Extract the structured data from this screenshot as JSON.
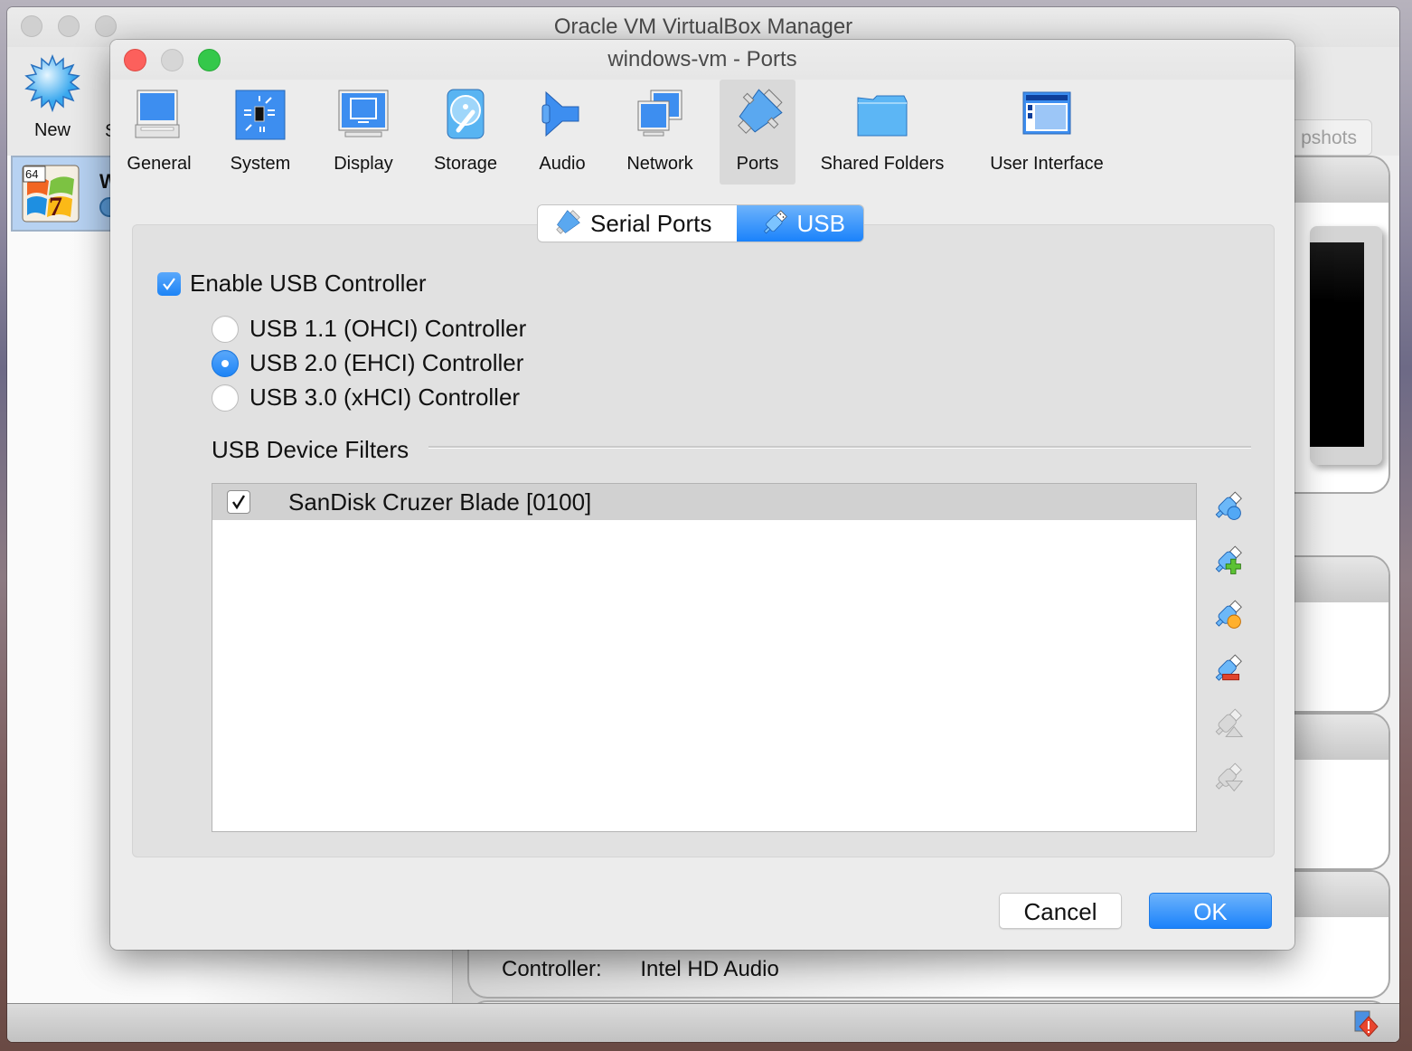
{
  "manager": {
    "title": "Oracle VM VirtualBox Manager",
    "toolbar": {
      "new_label": "New",
      "partial_label": "S",
      "snapshots_label": "Snapshots",
      "snapshots_visible": "pshots"
    },
    "vm_list": [
      {
        "name": "W",
        "os_badge": "64",
        "os_version": "7",
        "state_icon": "power-icon"
      }
    ],
    "details": {
      "audio_controller_label": "Controller:",
      "audio_controller_value": "Intel HD Audio"
    },
    "statusbar": {
      "icon": "network-warning-icon"
    }
  },
  "dialog": {
    "title": "windows-vm - Ports",
    "categories": [
      {
        "label": "General",
        "icon": "general-icon"
      },
      {
        "label": "System",
        "icon": "system-icon"
      },
      {
        "label": "Display",
        "icon": "display-icon"
      },
      {
        "label": "Storage",
        "icon": "storage-icon"
      },
      {
        "label": "Audio",
        "icon": "audio-icon"
      },
      {
        "label": "Network",
        "icon": "network-icon"
      },
      {
        "label": "Ports",
        "icon": "ports-icon",
        "selected": true
      },
      {
        "label": "Shared Folders",
        "icon": "shared-folders-icon"
      },
      {
        "label": "User Interface",
        "icon": "user-interface-icon"
      }
    ],
    "tabs": [
      {
        "label": "Serial Ports",
        "icon": "serial-port-icon",
        "selected": false
      },
      {
        "label": "USB",
        "icon": "usb-icon",
        "selected": true
      }
    ],
    "usb": {
      "enable_label": "Enable USB Controller",
      "enable_checked": true,
      "controllers": [
        {
          "label": "USB 1.1 (OHCI) Controller",
          "selected": false
        },
        {
          "label": "USB 2.0 (EHCI) Controller",
          "selected": true
        },
        {
          "label": "USB 3.0 (xHCI) Controller",
          "selected": false
        }
      ],
      "filters_label": "USB Device Filters",
      "filters": [
        {
          "label": "SanDisk Cruzer Blade [0100]",
          "checked": true
        }
      ],
      "filter_actions": [
        {
          "name": "add-empty-filter",
          "icon": "usb-add-empty-icon",
          "enabled": true
        },
        {
          "name": "add-filter-from-device",
          "icon": "usb-add-icon",
          "enabled": true
        },
        {
          "name": "edit-filter",
          "icon": "usb-edit-icon",
          "enabled": true
        },
        {
          "name": "remove-filter",
          "icon": "usb-remove-icon",
          "enabled": true
        },
        {
          "name": "move-filter-up",
          "icon": "usb-move-up-icon",
          "enabled": false
        },
        {
          "name": "move-filter-down",
          "icon": "usb-move-down-icon",
          "enabled": false
        }
      ]
    },
    "buttons": {
      "cancel": "Cancel",
      "ok": "OK"
    }
  },
  "colors": {
    "accent": "#1a82fb",
    "close": "#fc605c",
    "maximize": "#34c84a",
    "selection_bg": "#b7d2f2"
  }
}
